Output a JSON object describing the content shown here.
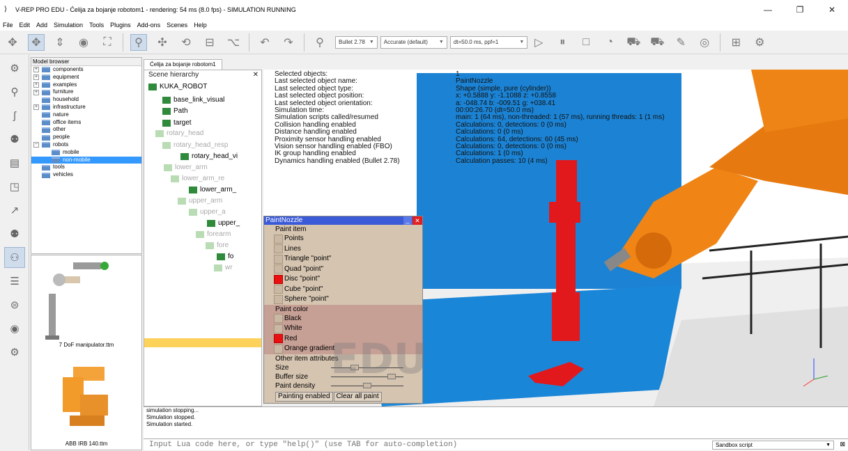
{
  "window": {
    "title": "V-REP PRO EDU - Ćelija za bojanje robotom1 - rendering: 54 ms (8.0 fps) - SIMULATION RUNNING",
    "controls": [
      "—",
      "❐",
      "✕"
    ]
  },
  "menu": [
    "File",
    "Edit",
    "Add",
    "Simulation",
    "Tools",
    "Plugins",
    "Add-ons",
    "Scenes",
    "Help"
  ],
  "toolbar": {
    "engine": "Bullet 2.78",
    "accuracy": "Accurate (default)",
    "timestep": "dt=50.0 ms, ppf=1"
  },
  "model_browser": {
    "header": "Model browser",
    "items": [
      {
        "label": "components",
        "expander": "+",
        "indent": 0,
        "selected": false
      },
      {
        "label": "equipment",
        "expander": "+",
        "indent": 0,
        "selected": false
      },
      {
        "label": "examples",
        "expander": "+",
        "indent": 0,
        "selected": false
      },
      {
        "label": "furniture",
        "expander": "+",
        "indent": 0,
        "selected": false
      },
      {
        "label": "household",
        "expander": "",
        "indent": 0,
        "selected": false
      },
      {
        "label": "infrastructure",
        "expander": "+",
        "indent": 0,
        "selected": false
      },
      {
        "label": "nature",
        "expander": "",
        "indent": 0,
        "selected": false
      },
      {
        "label": "office items",
        "expander": "",
        "indent": 0,
        "selected": false
      },
      {
        "label": "other",
        "expander": "",
        "indent": 0,
        "selected": false
      },
      {
        "label": "people",
        "expander": "",
        "indent": 0,
        "selected": false
      },
      {
        "label": "robots",
        "expander": "−",
        "indent": 0,
        "selected": false
      },
      {
        "label": "mobile",
        "expander": "",
        "indent": 1,
        "selected": false
      },
      {
        "label": "non-mobile",
        "expander": "",
        "indent": 1,
        "selected": true
      },
      {
        "label": "tools",
        "expander": "",
        "indent": 0,
        "selected": false
      },
      {
        "label": "vehicles",
        "expander": "",
        "indent": 0,
        "selected": false
      }
    ],
    "thumbnails": [
      "7 DoF manipulator.ttm",
      "ABB IRB 140.ttm"
    ]
  },
  "scene_tab": "Ćelija za bojanje robotom1",
  "hierarchy": {
    "header": "Scene hierarchy",
    "close": "✕",
    "items": [
      "KUKA_ROBOT",
      "base_link_visual",
      "Path",
      "target",
      "rotary_head",
      "rotary_head_resp",
      "rotary_head_vi",
      "lower_arm",
      "lower_arm_re",
      "lower_arm_",
      "upper_arm",
      "upper_a",
      "upper_",
      "forearm",
      "fore",
      "fo",
      "wr"
    ]
  },
  "info": {
    "rows": [
      {
        "k": "Selected objects:",
        "v": "1"
      },
      {
        "k": "Last selected object name:",
        "v": "PaintNozzle"
      },
      {
        "k": "Last selected object type:",
        "v": "Shape (simple, pure (cylinder))"
      },
      {
        "k": "Last selected object position:",
        "v": "x: +0.5888   y: -1.1088   z: +0.8558"
      },
      {
        "k": "Last selected object orientation:",
        "v": "a: -048.74   b: -009.51   g: +038.41"
      },
      {
        "k": "Simulation time:",
        "v": "00:00:26.70 (dt=50.0 ms)"
      },
      {
        "k": "Simulation scripts called/resumed",
        "v": "main: 1 (64 ms), non-threaded: 1 (57 ms), running threads: 1 (1 ms)"
      },
      {
        "k": "Collision handling enabled",
        "v": "Calculations: 0, detections: 0 (0 ms)"
      },
      {
        "k": "Distance handling enabled",
        "v": "Calculations: 0 (0 ms)"
      },
      {
        "k": "Proximity sensor handling enabled",
        "v": "Calculations: 64, detections: 60 (45 ms)"
      },
      {
        "k": "Vision sensor handling enabled (FBO)",
        "v": "Calculations: 0, detections: 0 (0 ms)"
      },
      {
        "k": "IK group handling enabled",
        "v": "Calculations: 1 (0 ms)"
      },
      {
        "k": "Dynamics handling enabled (Bullet 2.78)",
        "v": "Calculation passes: 10 (4 ms)"
      }
    ]
  },
  "paint_dialog": {
    "title": "PaintNozzle",
    "item_header": "Paint item",
    "items": [
      {
        "label": "Points",
        "on": false
      },
      {
        "label": "Lines",
        "on": false
      },
      {
        "label": "Triangle \"point\"",
        "on": false
      },
      {
        "label": "Quad \"point\"",
        "on": false
      },
      {
        "label": "Disc \"point\"",
        "on": true
      },
      {
        "label": "Cube \"point\"",
        "on": false
      },
      {
        "label": "Sphere \"point\"",
        "on": false
      }
    ],
    "color_header": "Paint color",
    "colors": [
      {
        "label": "Black",
        "on": false
      },
      {
        "label": "White",
        "on": false
      },
      {
        "label": "Red",
        "on": true
      },
      {
        "label": "Orange gradient",
        "on": false
      }
    ],
    "attr_header": "Other item attributes",
    "attrs": [
      {
        "label": "Size",
        "level": 0.3
      },
      {
        "label": "Buffer size",
        "level": 0.88
      },
      {
        "label": "Paint density",
        "level": 0.5
      }
    ],
    "btn_enabled": "Painting enabled",
    "btn_clear": "Clear all paint",
    "watermark": "EDU"
  },
  "console": [
    "simulation stopping...",
    "Simulation stopped.",
    "Simulation started."
  ],
  "lua": {
    "placeholder": "Input Lua code here, or type \"help()\" (use TAB for auto-completion)",
    "script": "Sandbox script"
  }
}
